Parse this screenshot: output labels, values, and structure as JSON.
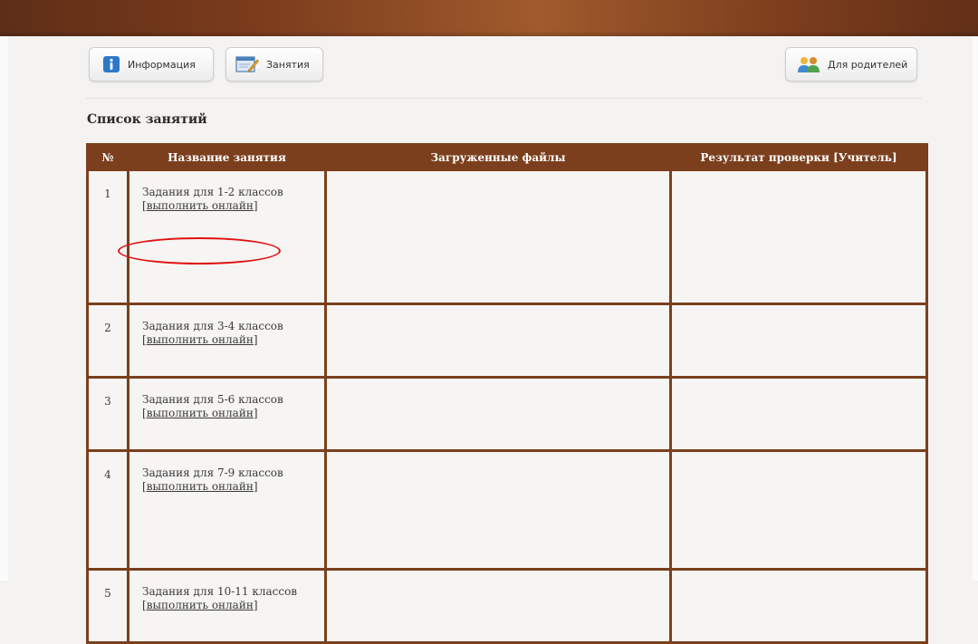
{
  "toolbar": {
    "info_label": "Информация",
    "lessons_label": "Занятия",
    "parents_label": "Для родителей"
  },
  "section": {
    "title": "Список занятий"
  },
  "table": {
    "headers": [
      "№",
      "Название занятия",
      "Загруженные файлы",
      "Результат проверки [Учитель]"
    ],
    "rows": [
      {
        "num": "1",
        "name": "Задания для 1-2 классов",
        "action": "выполнить онлайн"
      },
      {
        "num": "2",
        "name": "Задания для 3-4 классов",
        "action": "выполнить онлайн"
      },
      {
        "num": "3",
        "name": "Задания для 5-6 классов",
        "action": "выполнить онлайн"
      },
      {
        "num": "4",
        "name": "Задания для 7-9 классов",
        "action": "выполнить онлайн"
      },
      {
        "num": "5",
        "name": "Задания для 10-11 классов",
        "action": "выполнить онлайн"
      }
    ]
  },
  "colors": {
    "header_brown": "#7b3f1d",
    "annotation_red": "#e01010"
  },
  "icons": [
    "info-icon",
    "lessons-icon",
    "parents-icon"
  ]
}
